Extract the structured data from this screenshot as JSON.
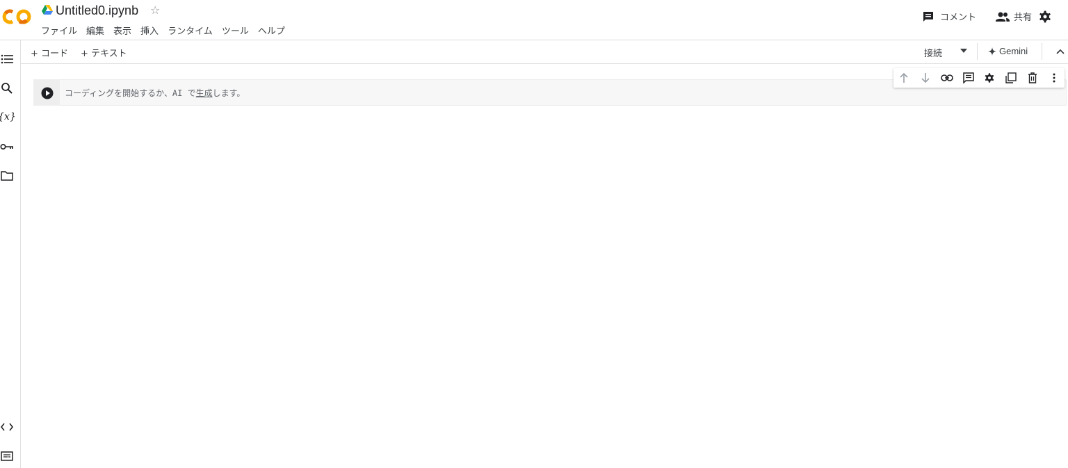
{
  "header": {
    "logo": "colab-logo",
    "file_name": "Untitled0.ipynb",
    "star_glyph": "☆",
    "menu": [
      "ファイル",
      "編集",
      "表示",
      "挿入",
      "ランタイム",
      "ツール",
      "ヘルプ"
    ],
    "comment_label": "コメント",
    "share_label": "共有"
  },
  "toolbar": {
    "add_code_label": "+ コード",
    "add_text_label": "+ テキスト",
    "connect_label": "接続",
    "gemini_label": "Gemini"
  },
  "left_rail": [
    "toc-icon",
    "search-icon",
    "variables-icon",
    "key-icon",
    "folder-icon",
    "code-snippets-icon",
    "terminal-icon"
  ],
  "cell": {
    "placeholder_prefix": "コーディングを開始するか、AI で",
    "placeholder_link": "生成",
    "placeholder_suffix": "します。"
  },
  "cell_toolbar": [
    "arrow-up-icon",
    "arrow-down-icon",
    "link-icon",
    "comment-icon",
    "settings-icon",
    "mirror-cell-icon",
    "delete-icon",
    "more-vert-icon"
  ],
  "colors": {
    "logo_orange": "#F9AB00",
    "logo_dark_orange": "#E8710A",
    "icon_gray": "#5f6368",
    "cell_bg": "#f7f7f7"
  }
}
